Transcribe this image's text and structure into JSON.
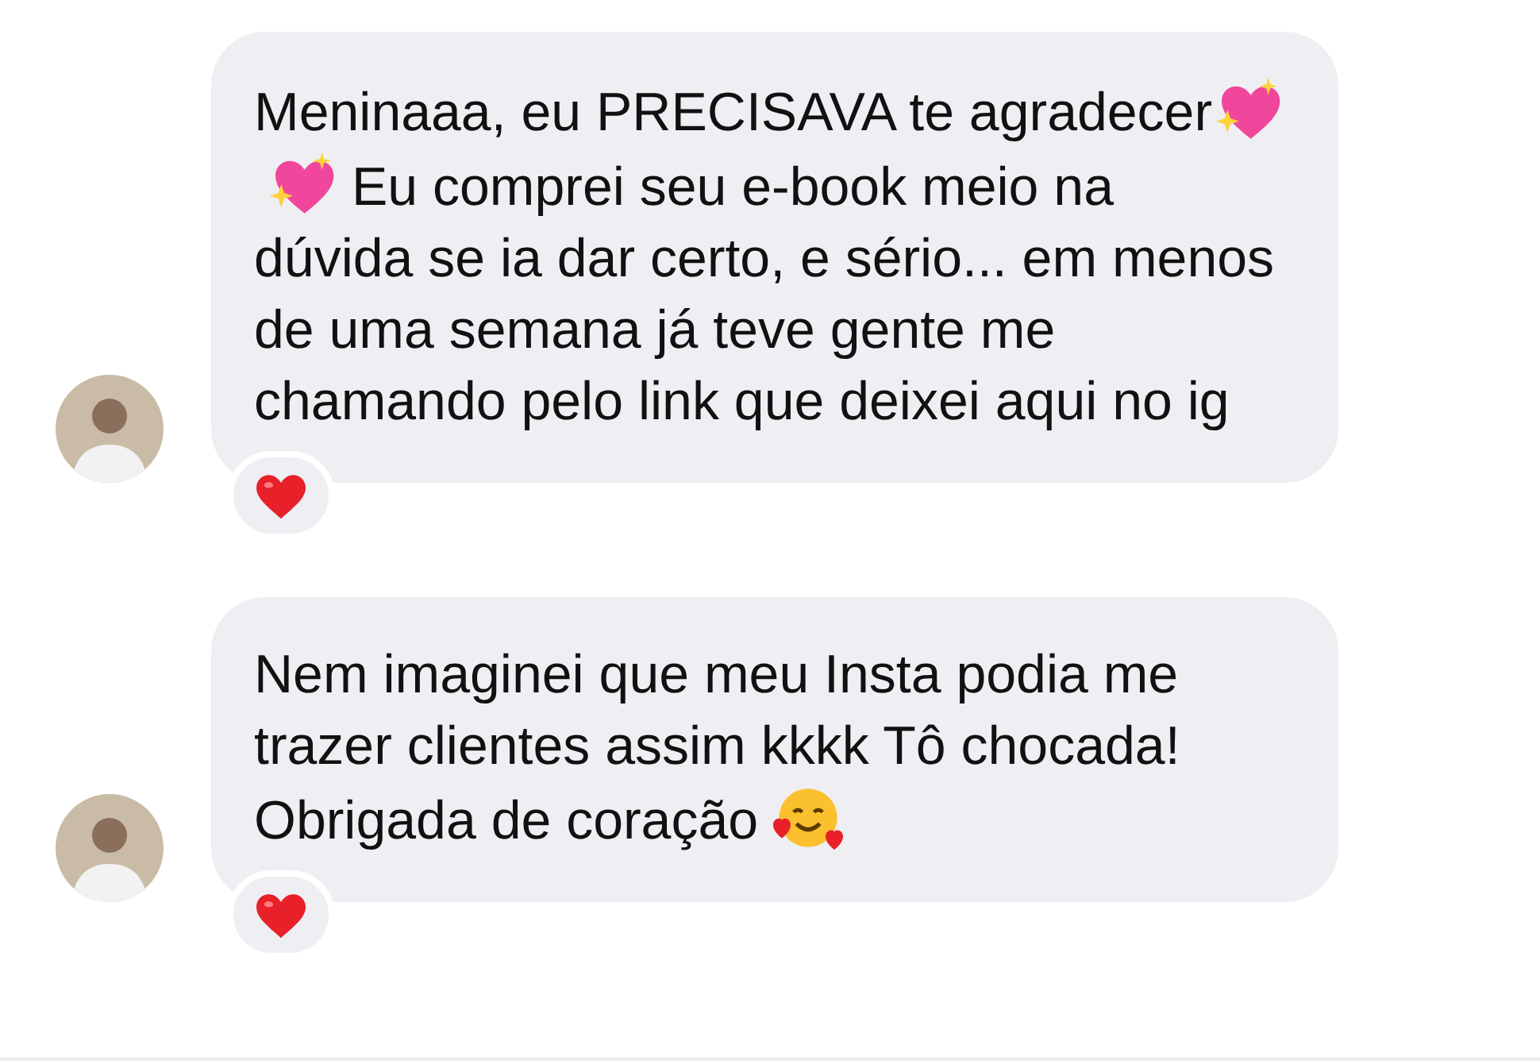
{
  "messages": [
    {
      "parts": [
        {
          "kind": "text",
          "text": "Meninaaa, eu PRECISAVA te agradecer"
        },
        {
          "kind": "sparkle-heart"
        },
        {
          "kind": "sparkle-heart"
        },
        {
          "kind": "text",
          "text": " Eu comprei seu e-book meio na dúvida se ia dar certo, e sério... em menos de uma semana já teve gente me chamando pelo link que deixei aqui no ig"
        }
      ],
      "heart_reaction": true
    },
    {
      "parts": [
        {
          "kind": "text",
          "text": "Nem imaginei que meu Insta podia me trazer clientes assim kkkk Tô chocada! Obrigada de coração "
        },
        {
          "kind": "smile-hearts"
        }
      ],
      "heart_reaction": true
    }
  ]
}
